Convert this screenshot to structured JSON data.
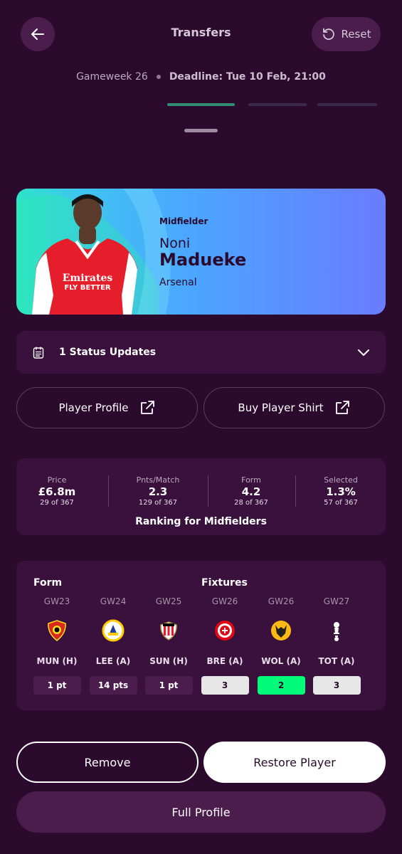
{
  "header": {
    "title": "Transfers",
    "reset_label": "Reset",
    "gameweek": "Gameweek 26",
    "deadline": "Deadline: Tue 10 Feb, 21:00"
  },
  "player": {
    "position": "Midfielder",
    "first_name": "Noni",
    "last_name": "Madueke",
    "team": "Arsenal",
    "shirt_sponsor_line1": "Emirates",
    "shirt_sponsor_line2": "FLY BETTER"
  },
  "status": {
    "label": "1 Status Updates"
  },
  "links": {
    "profile_label": "Player Profile",
    "shirt_label": "Buy Player Shirt"
  },
  "stats": {
    "items": [
      {
        "label": "Price",
        "value": "£6.8m",
        "rank": "29 of 367"
      },
      {
        "label": "Pnts/Match",
        "value": "2.3",
        "rank": "129 of 367"
      },
      {
        "label": "Form",
        "value": "4.2",
        "rank": "28 of 367"
      },
      {
        "label": "Selected",
        "value": "1.3%",
        "rank": "57 of 367"
      }
    ],
    "caption": "Ranking for Midfielders"
  },
  "form_fixtures": {
    "form_title": "Form",
    "fixtures_title": "Fixtures",
    "columns": [
      {
        "gw": "GW23",
        "opponent": "MUN (H)",
        "value": "1 pt",
        "crest": "man-utd-crest-icon",
        "color": "#da291c"
      },
      {
        "gw": "GW24",
        "opponent": "LEE (A)",
        "value": "14 pts",
        "crest": "leeds-crest-icon",
        "color": "#ffcd00"
      },
      {
        "gw": "GW25",
        "opponent": "SUN (H)",
        "value": "1 pt",
        "crest": "sunderland-crest-icon",
        "color": "#eb172b"
      },
      {
        "gw": "GW26",
        "opponent": "BRE (A)",
        "value": "3",
        "crest": "brentford-crest-icon",
        "color": "#e30613"
      },
      {
        "gw": "GW26",
        "opponent": "WOL (A)",
        "value": "2",
        "crest": "wolves-crest-icon",
        "color": "#fdb913"
      },
      {
        "gw": "GW27",
        "opponent": "TOT (A)",
        "value": "3",
        "crest": "tottenham-crest-icon",
        "color": "#132257"
      }
    ],
    "colors": {
      "form_pill": "#4a1d4d",
      "fdr_3": "#e7e7e7",
      "fdr_2": "#01fc7a"
    }
  },
  "actions": {
    "remove_label": "Remove",
    "restore_label": "Restore Player",
    "full_profile_label": "Full Profile"
  },
  "colors": {
    "background": "#2b0a2d",
    "card_gradient_start": "#2ee4c9",
    "card_gradient_end": "#6a7cff"
  }
}
